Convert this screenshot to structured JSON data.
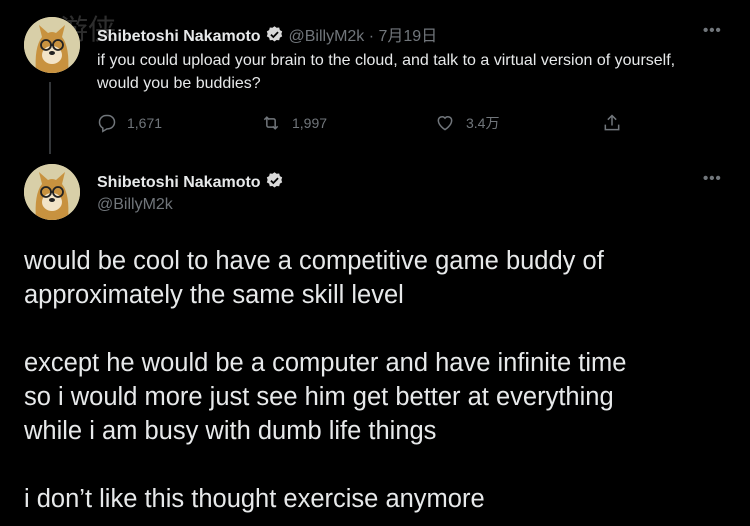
{
  "reply_to": {
    "author_name": "Shibetoshi Nakamoto",
    "handle_date": "@BillyM2k · 7月19日",
    "text": "if you could upload your brain to the cloud, and talk to a virtual version of yourself, would you be buddies?",
    "actions": {
      "replies": "1,671",
      "retweets": "1,997",
      "likes": "3.4万"
    },
    "more": "•••"
  },
  "tweet": {
    "author_name": "Shibetoshi Nakamoto",
    "handle": "@BillyM2k",
    "more": "•••",
    "paragraphs": [
      [
        "would be cool to have a competitive game buddy of",
        "approximately the same skill level"
      ],
      [
        "except he would be a computer and have infinite time",
        "so i would more just see him get better at everything",
        "while i am busy with dumb life things"
      ],
      [
        "i don’t like this thought exercise anymore"
      ]
    ]
  },
  "watermark": "游侠",
  "colors": {
    "background": "#000000",
    "text": "#e7e9ea",
    "muted": "#71767b",
    "verified": "#d9d9d9"
  },
  "icons": [
    "reply-icon",
    "retweet-icon",
    "like-icon",
    "share-icon",
    "verified-badge-icon",
    "more-icon"
  ]
}
